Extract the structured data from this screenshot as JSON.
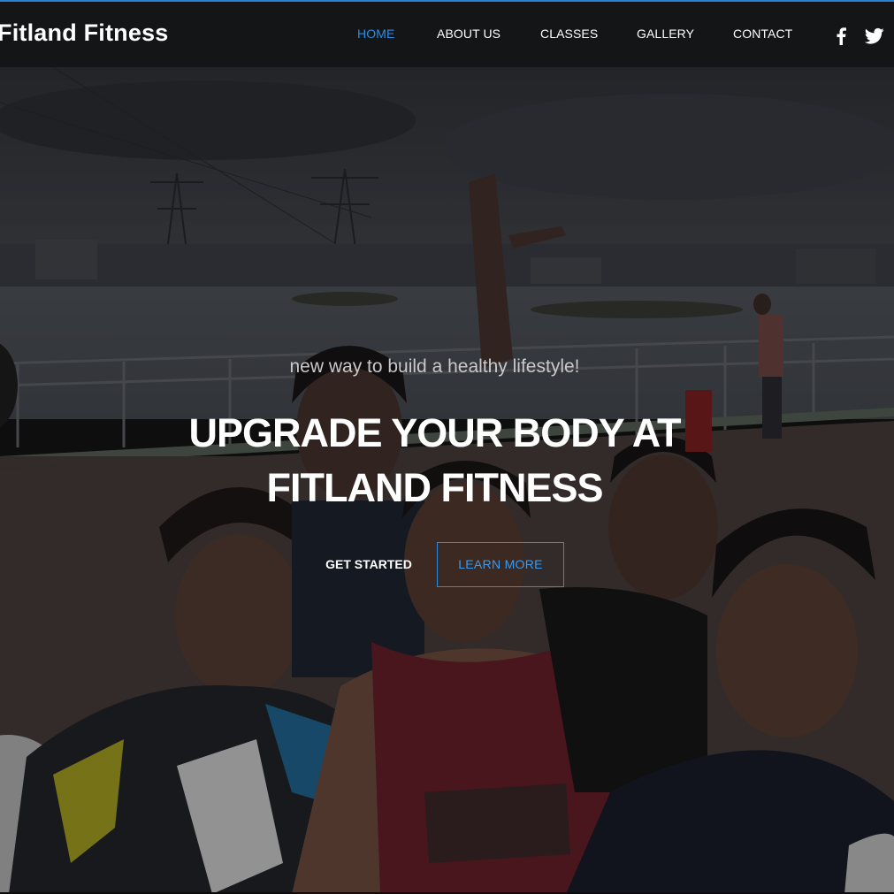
{
  "brand": {
    "name": "Fitland Fitness"
  },
  "nav": {
    "items": [
      {
        "label": "HOME",
        "active": true
      },
      {
        "label": "ABOUT US",
        "active": false
      },
      {
        "label": "CLASSES",
        "active": false
      },
      {
        "label": "GALLERY",
        "active": false
      },
      {
        "label": "CONTACT",
        "active": false
      }
    ],
    "social": [
      {
        "icon": "facebook-icon"
      },
      {
        "icon": "twitter-icon"
      }
    ]
  },
  "hero": {
    "tagline": "new way to build a healthy lifestyle!",
    "title_line1": "UPGRADE YOUR BODY AT",
    "title_line2": "FITLAND FITNESS",
    "primary_button": "GET STARTED",
    "secondary_button": "LEARN MORE"
  },
  "colors": {
    "accent": "#2b8ee6",
    "navbar_bg": "#141516",
    "text": "#ffffff"
  }
}
